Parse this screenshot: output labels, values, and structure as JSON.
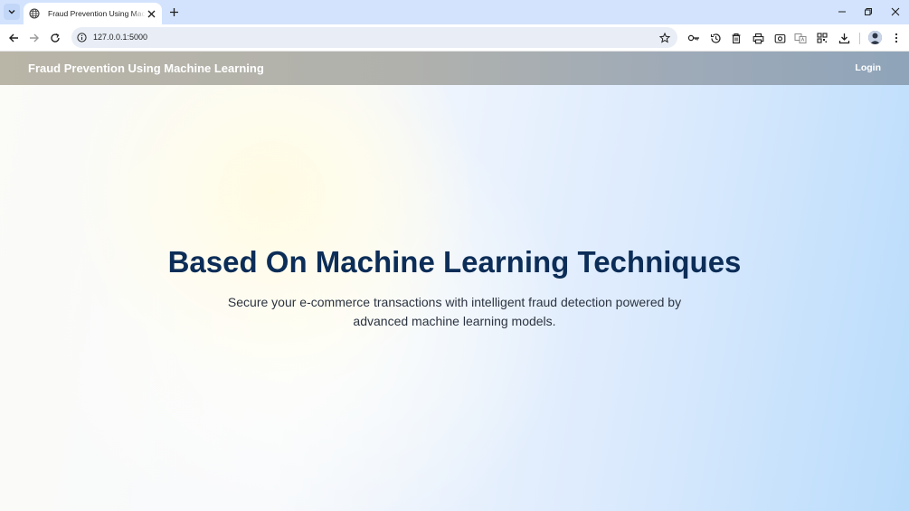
{
  "browser": {
    "tab": {
      "title": "Fraud Prevention Using Machine Learning"
    },
    "address_bar": {
      "url": "127.0.0.1:5000"
    }
  },
  "site": {
    "brand": "Fraud Prevention Using Machine Learning",
    "nav": {
      "login_label": "Login"
    }
  },
  "hero": {
    "title": "Based On Machine Learning Techniques",
    "subtitle": "Secure your e-commerce transactions with intelligent fraud detection powered by advanced machine learning models."
  },
  "colors": {
    "title_color": "#0c2d57",
    "tabstrip_bg": "#d3e3fd",
    "navbar_start": "#b9b5a7",
    "navbar_end": "#8fa4b9"
  }
}
